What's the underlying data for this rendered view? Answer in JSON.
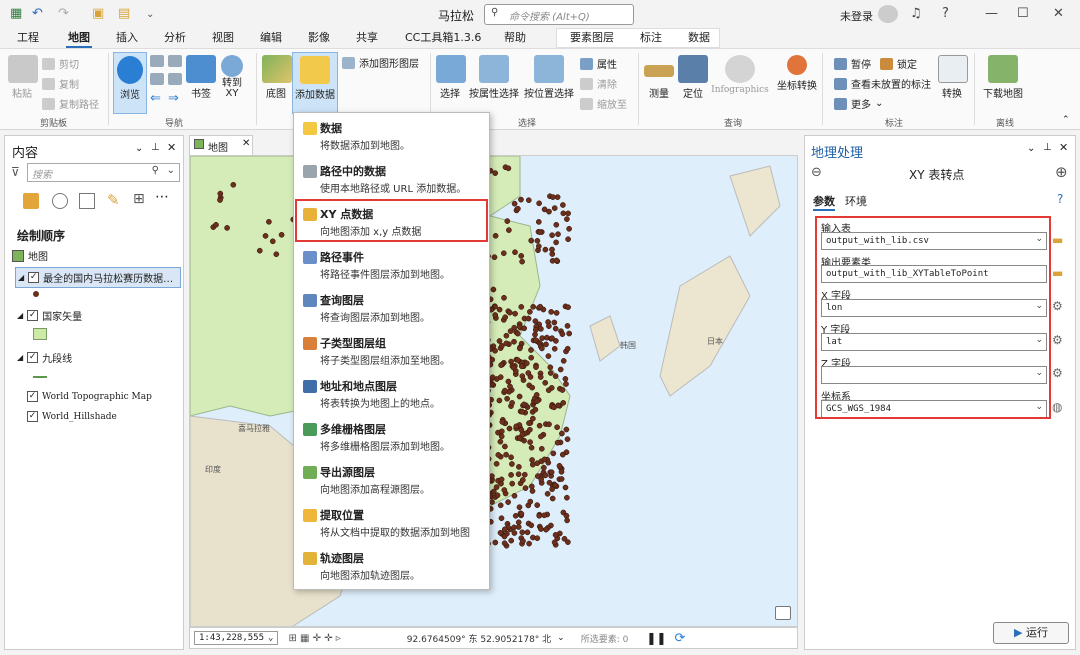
{
  "app": {
    "title": "马拉松",
    "command_search_placeholder": "命令搜索 (Alt+Q)",
    "signin": "未登录"
  },
  "ribbon_tabs": [
    "工程",
    "地图",
    "插入",
    "分析",
    "视图",
    "编辑",
    "影像",
    "共享",
    "CC工具箱1.3.6",
    "帮助",
    "要素图层",
    "标注",
    "数据"
  ],
  "active_tab": "地图",
  "ribbon": {
    "clipboard": {
      "paste": "粘贴",
      "cut": "剪切",
      "copy": "复制",
      "copy_path": "复制路径",
      "group": "剪贴板"
    },
    "navigate": {
      "explore": "浏览",
      "bookmarks": "书签",
      "goto_xy": "转到\nXY",
      "group": "导航"
    },
    "layer": {
      "basemap": "底图",
      "add_data": "添加数据",
      "add_graphics": "添加图形图层"
    },
    "selection": {
      "select": "选择",
      "by_attr": "按属性选择",
      "by_loc": "按位置选择",
      "attributes": "属性",
      "clear": "清除",
      "zoom_to": "缩放至",
      "group": "选择"
    },
    "inquiry": {
      "measure": "测量",
      "locate": "定位",
      "infographics": "Infographics",
      "coord_convert": "坐标转换",
      "group": "查询"
    },
    "labeling": {
      "pause": "暂停",
      "lock": "锁定",
      "unplaced": "查看未放置的标注",
      "more": "更多",
      "convert": "转换",
      "group": "标注"
    },
    "offline": {
      "download": "下载地图",
      "group": "离线"
    }
  },
  "contents": {
    "title": "内容",
    "search_placeholder": "搜索",
    "drawing_order": "绘制顺序",
    "layers": [
      {
        "name": "地图",
        "checked": true
      },
      {
        "name": "最全的国内马拉松赛历数据…",
        "checked": true,
        "selected": true
      },
      {
        "name": "国家矢量",
        "checked": true
      },
      {
        "name": "九段线",
        "checked": true
      },
      {
        "name": "World Topographic Map",
        "checked": true
      },
      {
        "name": "World_Hillshade",
        "checked": true
      }
    ]
  },
  "map": {
    "tab": "地图",
    "scale": "1:43,228,555",
    "coords": "92.6764509° 东 52.9052178° 北",
    "selected_features": "所选要素: 0",
    "labels": [
      "韩国",
      "日本",
      "喜马拉雅",
      "印度"
    ]
  },
  "add_data_menu": [
    {
      "title": "数据",
      "desc": "将数据添加到地图。",
      "color": "#f5c842"
    },
    {
      "title": "路径中的数据",
      "desc": "使用本地路径或 URL 添加数据。",
      "color": "#9aa4ad"
    },
    {
      "title": "XY 点数据",
      "desc": "向地图添加 x,y 点数据",
      "color": "#e8b13a",
      "highlighted": true
    },
    {
      "title": "路径事件",
      "desc": "将路径事件图层添加到地图。",
      "color": "#6b8fc9"
    },
    {
      "title": "查询图层",
      "desc": "将查询图层添加到地图。",
      "color": "#5f86bd"
    },
    {
      "title": "子类型图层组",
      "desc": "将子类型图层组添加至地图。",
      "color": "#d97f3a"
    },
    {
      "title": "地址和地点图层",
      "desc": "将表转换为地图上的地点。",
      "color": "#3f6ea8"
    },
    {
      "title": "多维栅格图层",
      "desc": "将多维栅格图层添加到地图。",
      "color": "#4a9a5a"
    },
    {
      "title": "导出源图层",
      "desc": "向地图添加高程源图层。",
      "color": "#6fae54"
    },
    {
      "title": "提取位置",
      "desc": "将从文档中提取的数据添加到地图",
      "color": "#f0b63a"
    },
    {
      "title": "轨迹图层",
      "desc": "向地图添加轨迹图层。",
      "color": "#e2b339"
    }
  ],
  "geoprocessing": {
    "panel_title": "地理处理",
    "tool_title": "XY 表转点",
    "tabs": [
      "参数",
      "环境"
    ],
    "params": [
      {
        "label": "输入表",
        "value": "output_with_lib.csv",
        "dropdown": true
      },
      {
        "label": "输出要素类",
        "value": "output_with_lib_XYTableToPoint",
        "dropdown": false
      },
      {
        "label": "X 字段",
        "value": "lon",
        "dropdown": true
      },
      {
        "label": "Y 字段",
        "value": "lat",
        "dropdown": true
      },
      {
        "label": "Z 字段",
        "value": "",
        "dropdown": true
      },
      {
        "label": "坐标系",
        "value": "GCS_WGS_1984",
        "dropdown": true
      }
    ],
    "run": "运行"
  }
}
